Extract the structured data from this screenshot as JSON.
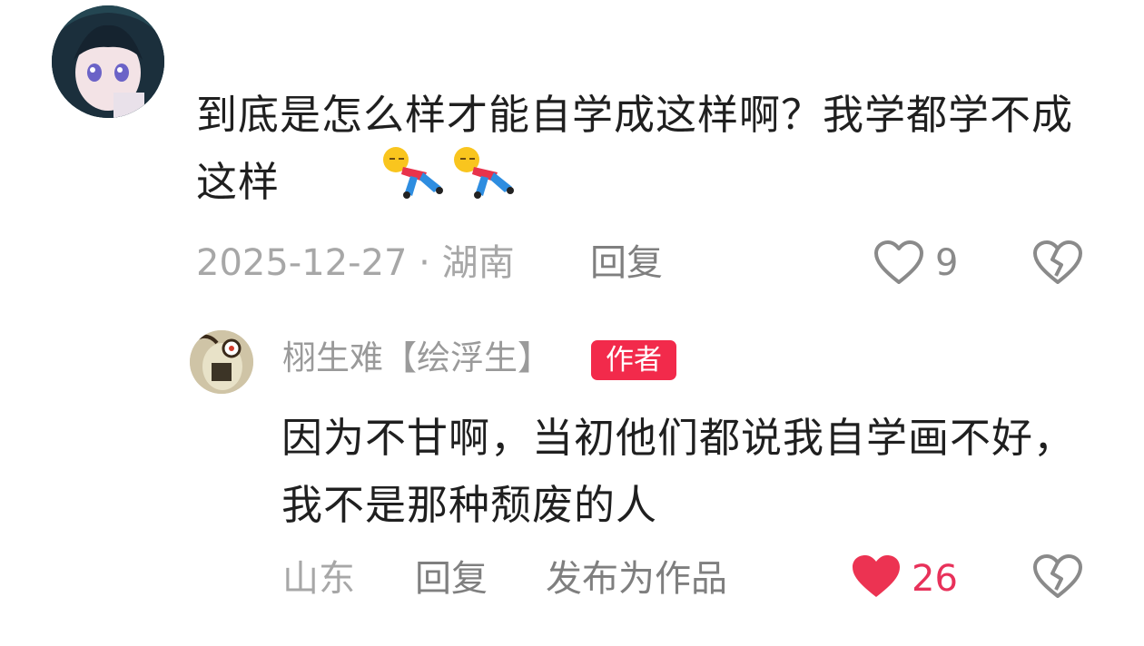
{
  "comment": {
    "text": "到底是怎么样才能自学成这样啊？我学都学不成这样",
    "emojis": [
      "falling-down-emoji",
      "falling-down-emoji"
    ],
    "date": "2025-12-27 · 湖南",
    "reply_label": "回复",
    "like_count": "9",
    "like_icon": "heart-outline-icon",
    "dislike_icon": "broken-heart-icon"
  },
  "reply": {
    "username": "栩生难【绘浮生】",
    "author_tag": "作者",
    "text": "因为不甘啊，当初他们都说我自学画不好，我不是那种颓废的人",
    "location": "山东",
    "reply_label": "回复",
    "publish_label": "发布为作品",
    "like_count": "26",
    "like_icon": "heart-filled-icon",
    "dislike_icon": "broken-heart-icon"
  },
  "colors": {
    "liked_heart": "#ec3352",
    "author_tag_bg": "#f22a4b",
    "meta_text": "#a7a7a7"
  }
}
